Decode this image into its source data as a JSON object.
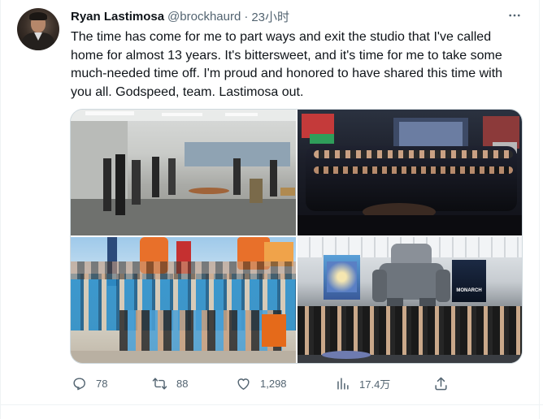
{
  "author": {
    "name": "Ryan Lastimosa",
    "handle": "@brockhaurd",
    "separator": "·",
    "time": "23小时"
  },
  "tweet": {
    "text": "The time has come for me to part ways and exit the studio that I've called home for almost 13 years. It's bittersweet, and it's time for me to take some much-needed time off. I'm proud and honored to have shared this time with you all. Godspeed, team. Lastimosa out."
  },
  "media": {
    "photo_4_posters": [
      "MONARCH"
    ]
  },
  "actions": {
    "replies": "78",
    "retweets": "88",
    "likes": "1,298",
    "views": "17.4万"
  },
  "icons": {
    "more": "more-dots-icon",
    "reply": "reply-icon",
    "retweet": "retweet-icon",
    "like": "heart-icon",
    "views": "views-bar-chart-icon",
    "share": "share-icon"
  },
  "colors": {
    "text": "#0f1419",
    "secondary": "#536471",
    "border": "#cfd9de"
  }
}
